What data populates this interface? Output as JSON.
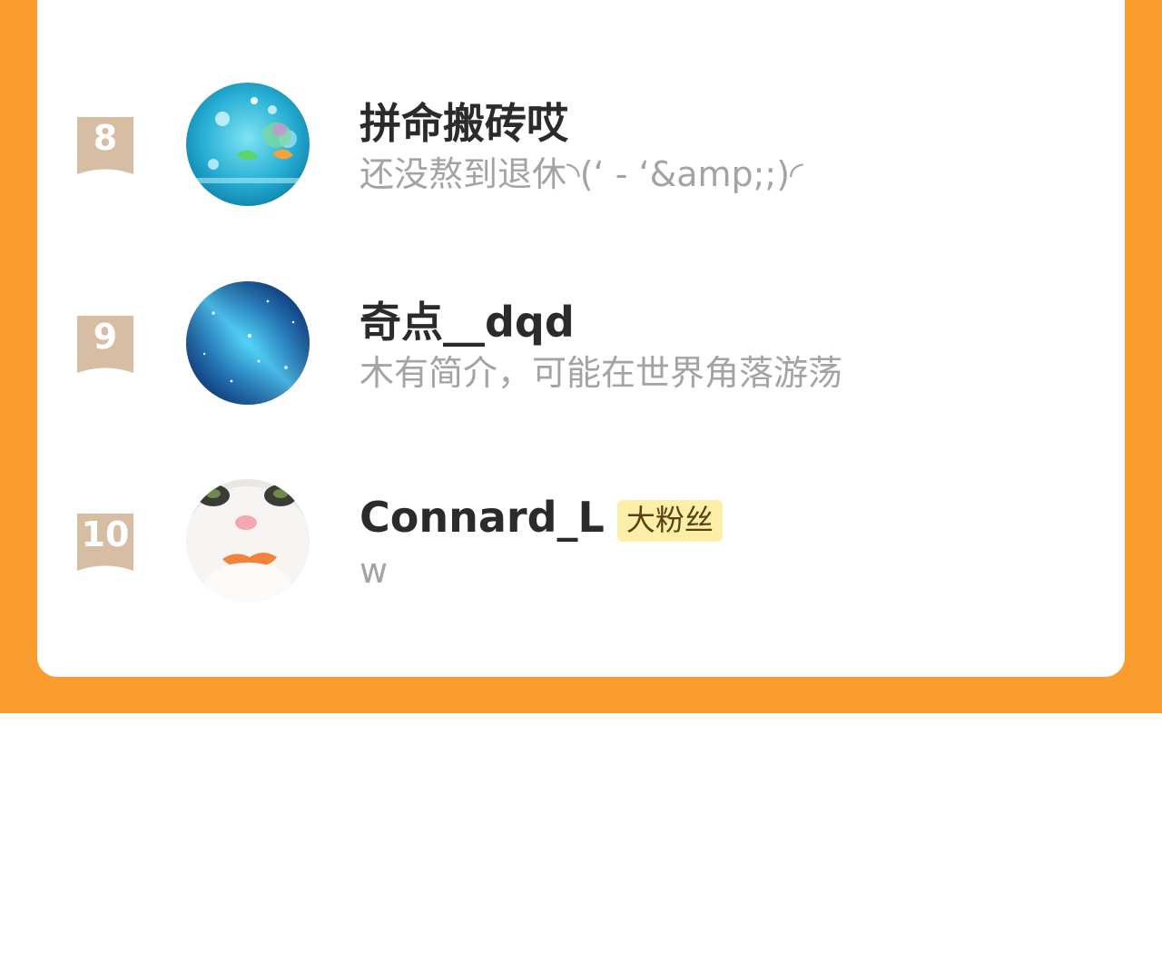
{
  "colors": {
    "page_background": "#fb9d2e",
    "card_background": "#ffffff",
    "rank_badge": "#d7bda4",
    "name_text": "#2b2b2b",
    "bio_text": "#a3a3a3",
    "fan_badge_bg": "#fdefa8",
    "fan_badge_text": "#5a3f10"
  },
  "ranking": {
    "items": [
      {
        "rank": "8",
        "name": "拼命搬砖哎",
        "bio": "还没熬到退休◝(ʻ - ʻ&amp;;)◜",
        "badge": "",
        "avatar_icon": "ocean-bubbles-avatar"
      },
      {
        "rank": "9",
        "name": "奇点__dqd",
        "bio": "木有简介，可能在世界角落游荡",
        "badge": "",
        "avatar_icon": "galaxy-avatar"
      },
      {
        "rank": "10",
        "name": "Connard_L",
        "bio": "w",
        "badge": "大粉丝",
        "avatar_icon": "cat-avatar"
      }
    ]
  }
}
